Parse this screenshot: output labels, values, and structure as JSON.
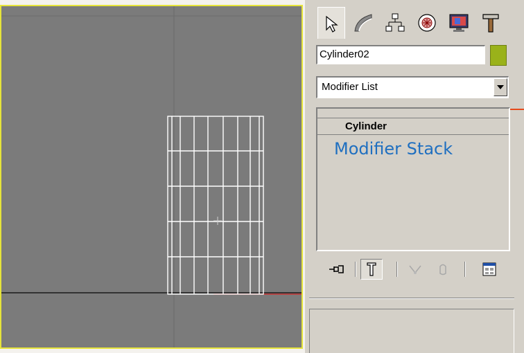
{
  "viewport": {
    "background": "#7b7b7b",
    "border_color": "#e6e43a",
    "object": "cylinder-wireframe",
    "wireframe_color": "#ffffff"
  },
  "command_panel": {
    "tabs": [
      {
        "name": "create",
        "icon": "cursor-arrow-icon",
        "active": true
      },
      {
        "name": "modify",
        "icon": "modify-curve-icon",
        "active": false
      },
      {
        "name": "hierarchy",
        "icon": "hierarchy-icon",
        "active": false
      },
      {
        "name": "motion",
        "icon": "motion-icon",
        "active": false
      },
      {
        "name": "display",
        "icon": "display-icon",
        "active": false
      },
      {
        "name": "utilities",
        "icon": "hammer-icon",
        "active": false
      }
    ],
    "object_name": "Cylinder02",
    "object_color": "#9ab21a",
    "modifier_list": {
      "selected": "Modifier List"
    },
    "modifier_stack": {
      "items": [
        "Cylinder"
      ],
      "annotation": "Modifier Stack",
      "annotation_color": "#1f6fc0"
    },
    "stack_toolbar": [
      {
        "name": "pin-stack",
        "icon": "pin-icon"
      },
      {
        "name": "show-end-result",
        "icon": "end-result-icon",
        "pressed": true
      },
      {
        "name": "make-unique",
        "icon": "make-unique-icon"
      },
      {
        "name": "remove-modifier",
        "icon": "remove-modifier-icon"
      },
      {
        "name": "configure-sets",
        "icon": "configure-sets-icon"
      }
    ]
  }
}
